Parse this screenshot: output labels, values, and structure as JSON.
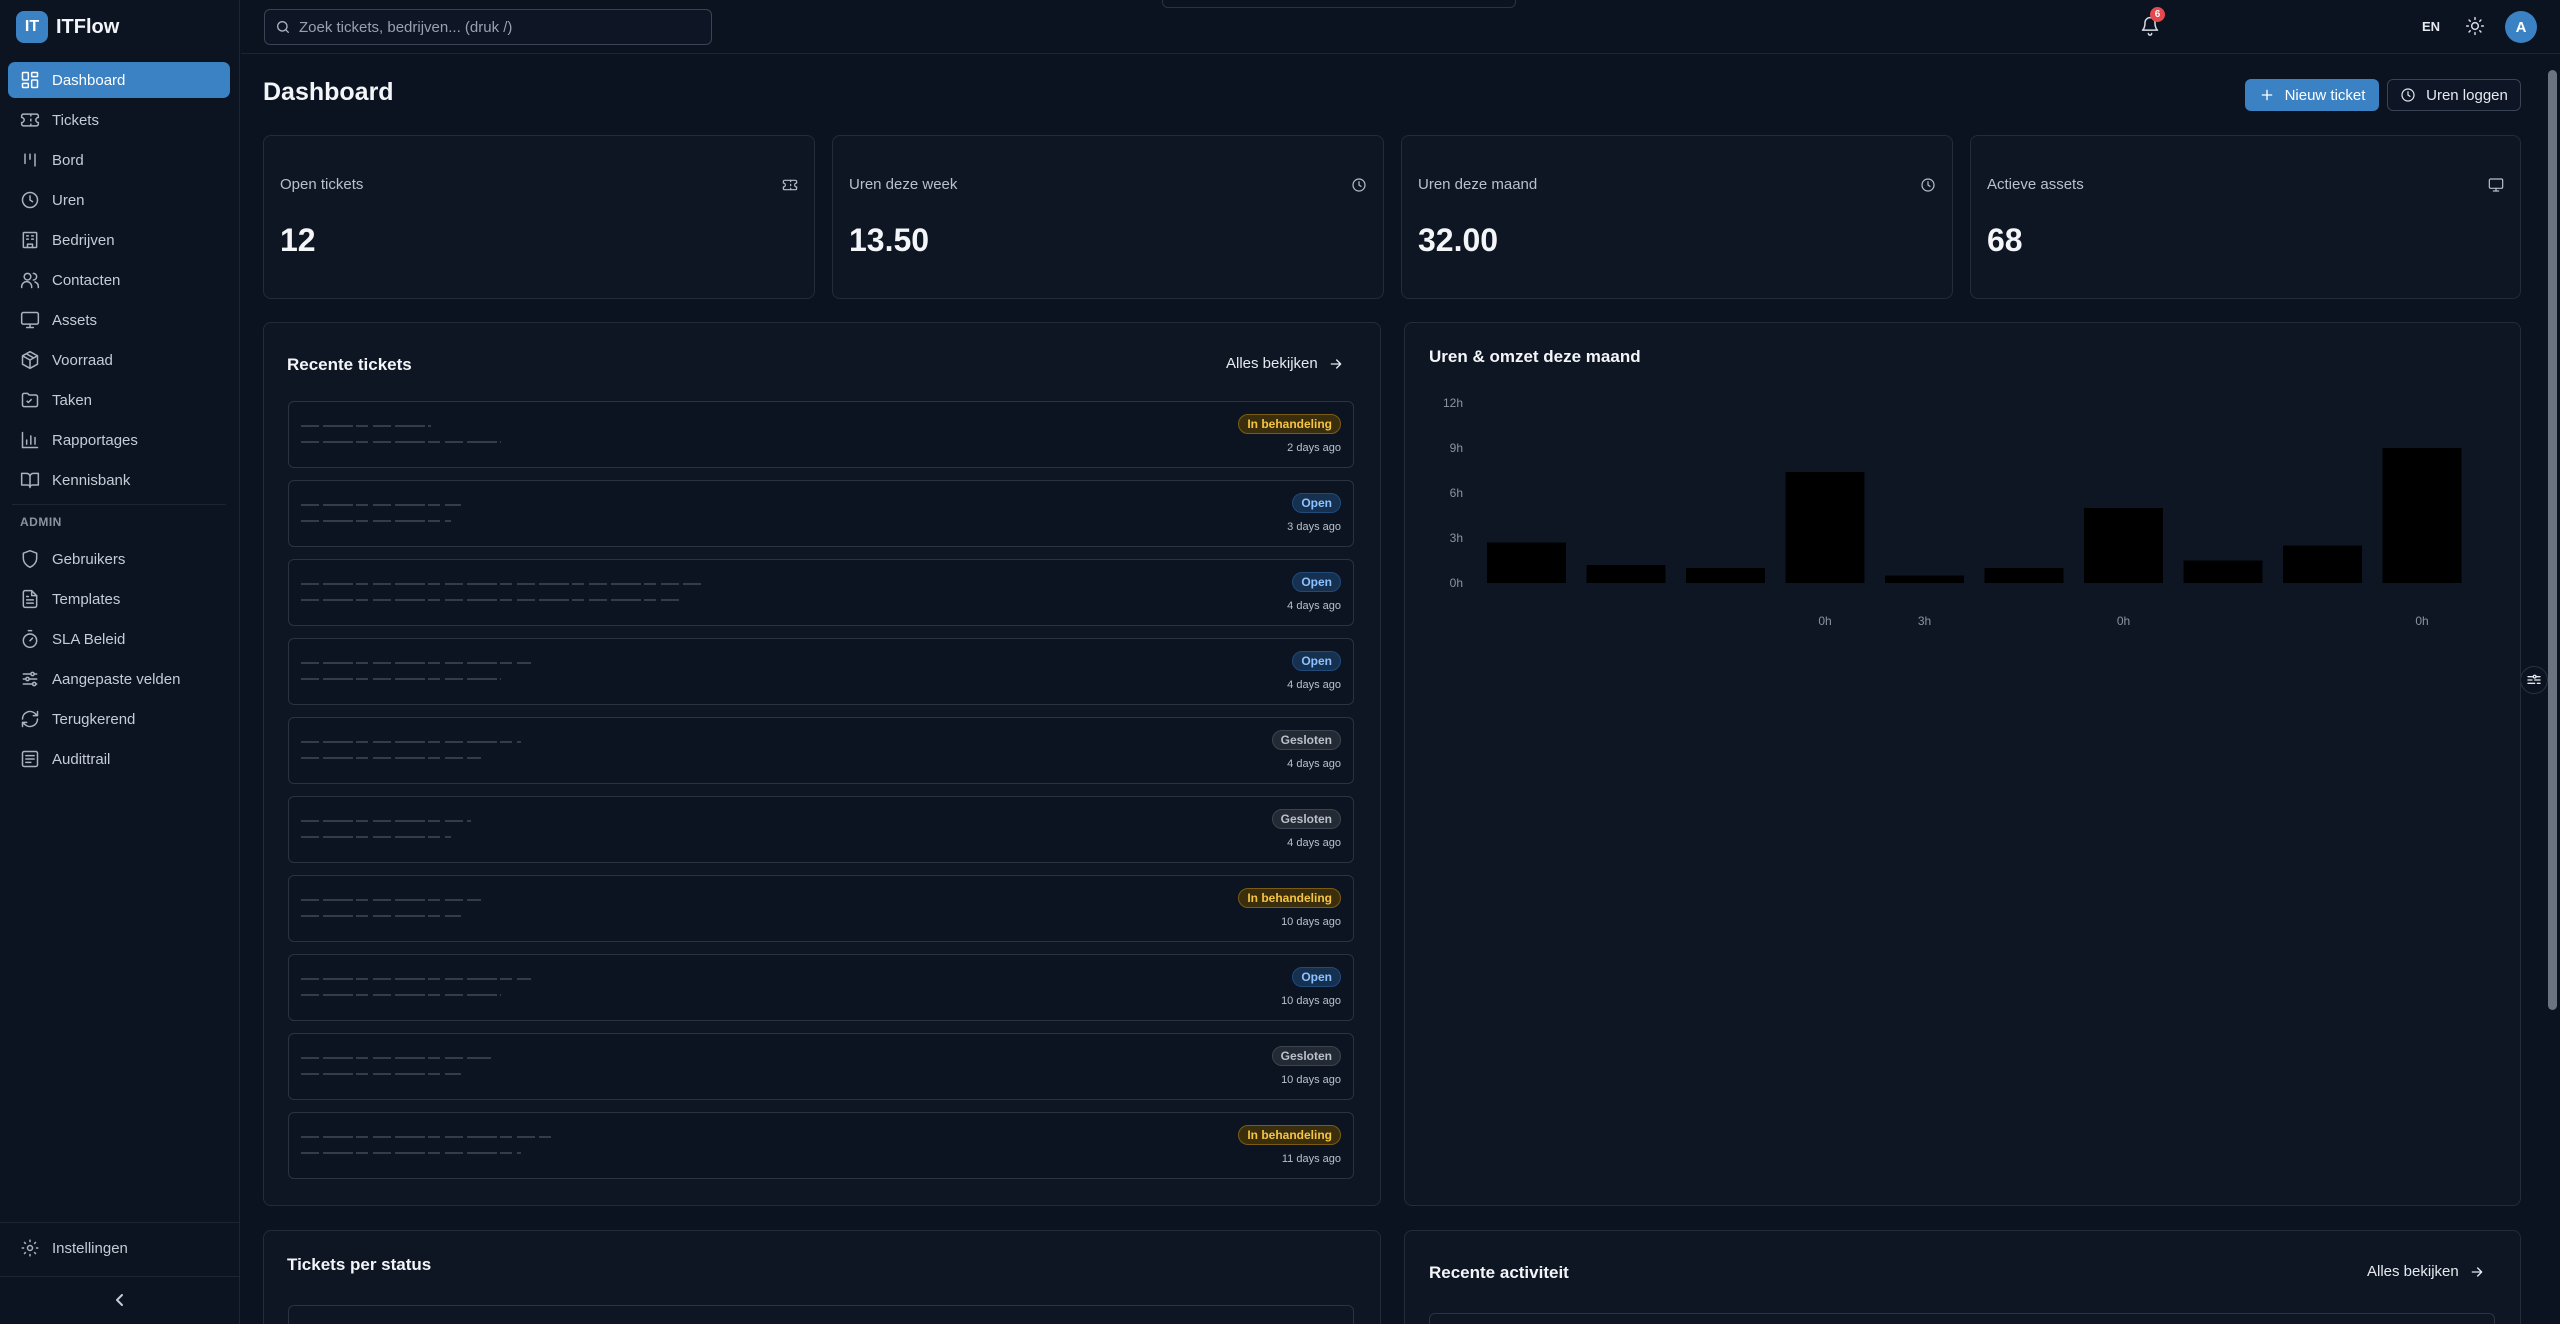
{
  "app": {
    "logo_text": "IT",
    "name": "ITFlow"
  },
  "search": {
    "placeholder": "Zoek tickets, bedrijven... (druk /)"
  },
  "topbar": {
    "notification_count": "6",
    "language": "EN",
    "avatar_initial": "A"
  },
  "sidebar": {
    "items": [
      {
        "label": "Dashboard",
        "icon": "dashboard-icon",
        "active": true
      },
      {
        "label": "Tickets",
        "icon": "ticket-icon"
      },
      {
        "label": "Bord",
        "icon": "kanban-icon"
      },
      {
        "label": "Uren",
        "icon": "clock-icon"
      },
      {
        "label": "Bedrijven",
        "icon": "building-icon"
      },
      {
        "label": "Contacten",
        "icon": "users-icon"
      },
      {
        "label": "Assets",
        "icon": "monitor-icon"
      },
      {
        "label": "Voorraad",
        "icon": "package-icon"
      },
      {
        "label": "Taken",
        "icon": "folder-icon"
      },
      {
        "label": "Rapportages",
        "icon": "bar-chart-icon"
      },
      {
        "label": "Kennisbank",
        "icon": "book-icon"
      }
    ],
    "admin_label": "ADMIN",
    "admin_items": [
      {
        "label": "Gebruikers",
        "icon": "shield-icon"
      },
      {
        "label": "Templates",
        "icon": "file-text-icon"
      },
      {
        "label": "SLA Beleid",
        "icon": "timer-icon"
      },
      {
        "label": "Aangepaste velden",
        "icon": "sliders-icon"
      },
      {
        "label": "Terugkerend",
        "icon": "refresh-icon"
      },
      {
        "label": "Audittrail",
        "icon": "list-icon"
      }
    ],
    "settings_label": "Instellingen"
  },
  "page": {
    "title": "Dashboard",
    "new_ticket_label": "Nieuw ticket",
    "log_hours_label": "Uren loggen"
  },
  "stats": [
    {
      "label": "Open tickets",
      "value": "12",
      "icon": "ticket-icon"
    },
    {
      "label": "Uren deze week",
      "value": "13.50",
      "icon": "clock-icon"
    },
    {
      "label": "Uren deze maand",
      "value": "32.00",
      "icon": "clock-icon"
    },
    {
      "label": "Actieve assets",
      "value": "68",
      "icon": "monitor-icon"
    }
  ],
  "recent_tickets": {
    "title": "Recente tickets",
    "see_all_label": "Alles bekijken",
    "rows": [
      {
        "status": "In behandeling",
        "status_key": "in-behandeling",
        "ago": "2 days ago"
      },
      {
        "status": "Open",
        "status_key": "open",
        "ago": "3 days ago"
      },
      {
        "status": "Open",
        "status_key": "open",
        "ago": "4 days ago"
      },
      {
        "status": "Open",
        "status_key": "open",
        "ago": "4 days ago"
      },
      {
        "status": "Gesloten",
        "status_key": "gesloten",
        "ago": "4 days ago"
      },
      {
        "status": "Gesloten",
        "status_key": "gesloten",
        "ago": "4 days ago"
      },
      {
        "status": "In behandeling",
        "status_key": "in-behandeling",
        "ago": "10 days ago"
      },
      {
        "status": "Open",
        "status_key": "open",
        "ago": "10 days ago"
      },
      {
        "status": "Gesloten",
        "status_key": "gesloten",
        "ago": "10 days ago"
      },
      {
        "status": "In behandeling",
        "status_key": "in-behandeling",
        "ago": "11 days ago"
      }
    ]
  },
  "tickets_per_status": {
    "title": "Tickets per status"
  },
  "recent_activity": {
    "title": "Recente activiteit",
    "see_all_label": "Alles bekijken"
  },
  "chart_data": {
    "type": "bar",
    "title": "Uren & omzet deze maand",
    "yticks": [
      "12h",
      "9h",
      "6h",
      "3h",
      "0h"
    ],
    "ylim": [
      0,
      12
    ],
    "values": [
      2.7,
      1.2,
      1.0,
      7.4,
      0.5,
      1.0,
      5.0,
      1.5,
      2.5,
      9.0
    ],
    "x_labels": [
      "",
      "",
      "",
      "0h",
      "3h",
      "",
      "0h",
      "",
      "",
      "0h"
    ],
    "grid": false,
    "bar_color": "#000000"
  },
  "colors": {
    "accent": "#3b82c4",
    "background": "#0b1220",
    "card": "#0e1624",
    "badge_in_behandeling": "#f5c542",
    "badge_open": "#8cc2ff",
    "badge_gesloten": "#b8c0cb",
    "notification": "#e5484d"
  }
}
